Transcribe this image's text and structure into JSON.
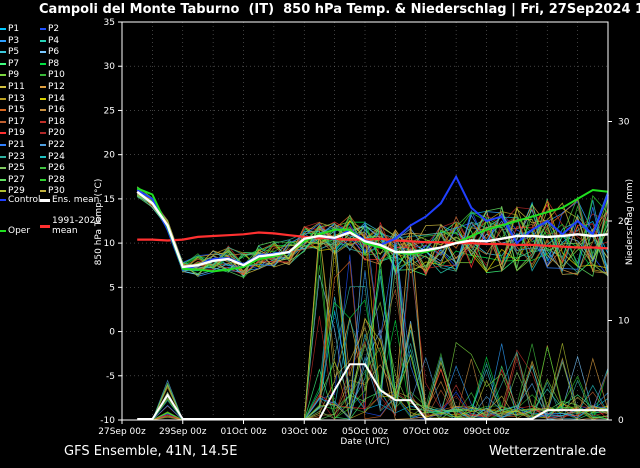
{
  "title": "Campoli del Monte Taburno  (IT)  850 hPa Temp. & Niederschlag | Fri, 27Sep2024 12Z",
  "footer": {
    "left": "GFS Ensemble, 41N, 14.5E",
    "right": "Wetterzentrale.de"
  },
  "legend": {
    "members": [
      "P1",
      "P2",
      "P3",
      "P4",
      "P5",
      "P6",
      "P7",
      "P8",
      "P9",
      "P10",
      "P11",
      "P12",
      "P13",
      "P14",
      "P15",
      "P16",
      "P17",
      "P18",
      "P19",
      "P20",
      "P21",
      "P22",
      "P23",
      "P24",
      "P25",
      "P26",
      "P27",
      "P28",
      "P29",
      "P30"
    ],
    "member_colors": [
      "#00c8ff",
      "#1e50ff",
      "#2ea0ff",
      "#28d2b4",
      "#3cc8dc",
      "#7ac8ff",
      "#40ff80",
      "#00e040",
      "#7cd840",
      "#38b838",
      "#d2c040",
      "#e0a040",
      "#bca020",
      "#d8d000",
      "#d86820",
      "#c89040",
      "#c06030",
      "#c03028",
      "#ff3030",
      "#b02828",
      "#3080ff",
      "#50a0e0",
      "#30b0a0",
      "#20c0c0",
      "#80c860",
      "#40c040",
      "#60e060",
      "#30d030",
      "#b0c030",
      "#c0b040"
    ],
    "control": "Control",
    "ens_mean": "Ens. mean",
    "clim_mean": "1991-2020\nmean",
    "oper": "Oper"
  },
  "colors": {
    "control": "#2040ff",
    "ens_mean": "#ffffff",
    "clim_mean": "#ff3030",
    "oper": "#20e020"
  },
  "chart_data": {
    "type": "line",
    "xlabel": "Date (UTC)",
    "ylabel": "850 hPa Temp. (°C)",
    "y2label": "Niederschlag (mm)",
    "ylim": [
      -10,
      35
    ],
    "y2lim": [
      0,
      40
    ],
    "x_ticks": [
      "27Sep 00z",
      "29Sep 00z",
      "01Oct 00z",
      "03Oct 00z",
      "05Oct 00z",
      "07Oct 00z",
      "09Oct 00z"
    ],
    "y_ticks": [
      -10,
      -5,
      0,
      5,
      10,
      15,
      20,
      25,
      30,
      35
    ],
    "y2_ticks": [
      0,
      10,
      20,
      30
    ],
    "x_days": [
      0.5,
      1,
      1.5,
      2,
      2.5,
      3,
      3.5,
      4,
      4.5,
      5,
      5.5,
      6,
      6.5,
      7,
      7.5,
      8,
      8.5,
      9,
      9.5,
      10,
      10.5,
      11,
      11.5,
      12,
      12.5,
      13,
      13.5,
      14,
      14.5,
      15,
      15.5,
      16
    ],
    "series": [
      {
        "name": "1991-2020 mean",
        "values": [
          10.4,
          10.4,
          10.3,
          10.4,
          10.7,
          10.8,
          10.9,
          11.0,
          11.2,
          11.1,
          10.9,
          10.7,
          10.6,
          10.5,
          10.4,
          10.4,
          10.5,
          10.3,
          10.2,
          10.1,
          10.1,
          10.0,
          10.0,
          9.9,
          9.9,
          9.8,
          9.8,
          9.7,
          9.6,
          9.5,
          9.5,
          9.4
        ]
      },
      {
        "name": "Ens. mean",
        "values": [
          15.8,
          14.5,
          12.0,
          7.3,
          7.5,
          8.0,
          8.2,
          7.5,
          8.5,
          8.7,
          9.0,
          10.5,
          10.8,
          10.6,
          11.2,
          10.2,
          9.8,
          9.0,
          9.0,
          9.2,
          9.5,
          10.0,
          10.3,
          10.2,
          10.5,
          10.8,
          10.8,
          10.7,
          10.8,
          11.0,
          10.8,
          11.0
        ]
      },
      {
        "name": "Control",
        "values": [
          16.0,
          15.0,
          11.5,
          7.0,
          7.5,
          8.2,
          8.3,
          7.6,
          8.6,
          8.8,
          9.0,
          10.5,
          10.8,
          10.5,
          11.5,
          10.3,
          9.8,
          10.5,
          12.0,
          13.0,
          14.5,
          17.5,
          14.0,
          12.5,
          13.0,
          10.0,
          11.5,
          12.5,
          11.0,
          12.5,
          11.0,
          15.5
        ]
      },
      {
        "name": "Oper",
        "values": [
          16.2,
          15.5,
          11.8,
          7.1,
          7.0,
          6.8,
          7.0,
          7.3,
          8.2,
          8.5,
          9.0,
          10.2,
          11.0,
          11.5,
          11.5,
          10.0,
          9.5,
          9.0,
          8.8,
          9.0,
          9.5,
          10.0,
          10.8,
          11.5,
          12.0,
          12.5,
          13.0,
          13.5,
          14.0,
          15.0,
          16.0,
          15.8
        ]
      }
    ]
  }
}
